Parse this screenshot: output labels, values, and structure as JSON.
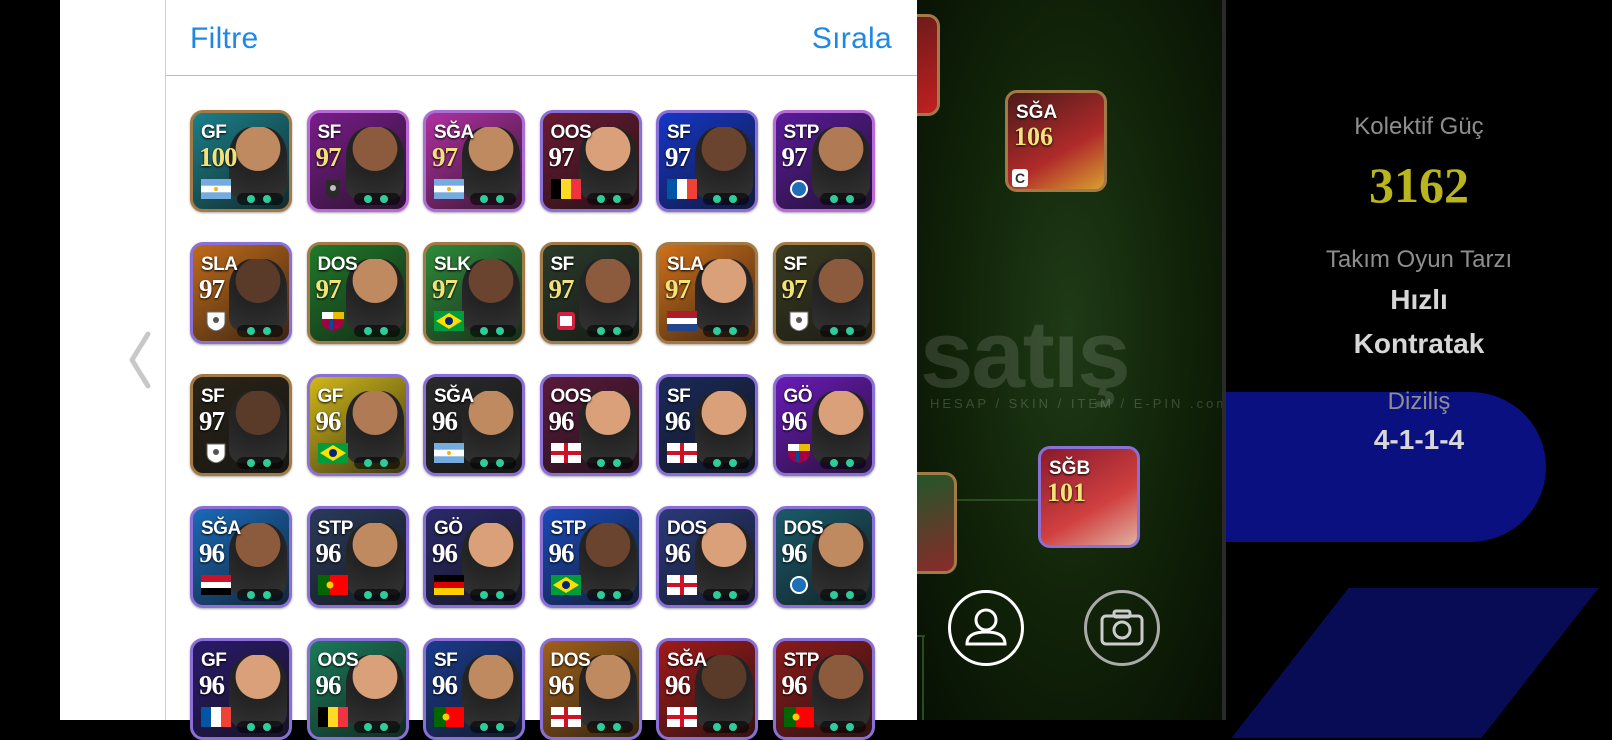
{
  "header": {
    "filter_label": "Filtre",
    "sort_label": "Sırala"
  },
  "watermark": {
    "brand": "satış",
    "tagline": "HESAP / SKIN / ITEM / E-PIN",
    "domain": ".com"
  },
  "team": {
    "power_label": "Kolektif Güç",
    "power_value": "3162",
    "style_label": "Takım Oyun Tarzı",
    "style_value_line1": "Hızlı",
    "style_value_line2": "Kontratak",
    "formation_label": "Diziliş",
    "formation_value": "4-1-1-4"
  },
  "pitch_cards": [
    {
      "pos": "SĞA",
      "rating": "106",
      "marker": "C"
    },
    {
      "pos": "SĞB",
      "rating": "101"
    }
  ],
  "icons": {
    "profile": "person-icon",
    "camera": "camera-icon",
    "back": "chevron-left-icon"
  },
  "cards": [
    {
      "pos": "GF",
      "rating": "100",
      "gold": true,
      "flag": "argentina",
      "bg": "#1a7f8a",
      "frame": "#a27a45",
      "skin": "#c08a60"
    },
    {
      "pos": "SF",
      "rating": "97",
      "gold": true,
      "flag": "club-dark",
      "bg": "#7a1c8a",
      "frame": "#b86bd6",
      "skin": "#8c5a3c"
    },
    {
      "pos": "SĞA",
      "rating": "97",
      "gold": true,
      "flag": "argentina",
      "bg": "#b030a0",
      "frame": "#a86fd6",
      "skin": "#c08a60"
    },
    {
      "pos": "OOS",
      "rating": "97",
      "gold": false,
      "flag": "belgium",
      "bg": "#6a1a32",
      "frame": "#8a6fd6",
      "skin": "#d9a07a"
    },
    {
      "pos": "SF",
      "rating": "97",
      "gold": false,
      "flag": "france",
      "bg": "#1536c8",
      "frame": "#8a6fd6",
      "skin": "#6b4430"
    },
    {
      "pos": "STP",
      "rating": "97",
      "gold": false,
      "flag": "club-blue",
      "bg": "#5a1a9a",
      "frame": "#b86bd6",
      "skin": "#b07a55"
    },
    {
      "pos": "SLA",
      "rating": "97",
      "gold": false,
      "flag": "club-white",
      "bg": "#c06a1a",
      "frame": "#8a6fd6",
      "skin": "#5a3a28"
    },
    {
      "pos": "DOS",
      "rating": "97",
      "gold": true,
      "flag": "barcelona",
      "bg": "#1f7a2a",
      "frame": "#a27a45",
      "skin": "#c08a60"
    },
    {
      "pos": "SLK",
      "rating": "97",
      "gold": true,
      "flag": "brazil",
      "bg": "#2e8a3a",
      "frame": "#a27a45",
      "skin": "#6b4430"
    },
    {
      "pos": "SF",
      "rating": "97",
      "gold": true,
      "flag": "club-red",
      "bg": "#2a3a2a",
      "frame": "#a27a45",
      "skin": "#8c5a3c"
    },
    {
      "pos": "SLA",
      "rating": "97",
      "gold": true,
      "flag": "netherlands",
      "bg": "#d0701a",
      "frame": "#a27a45",
      "skin": "#d9a07a"
    },
    {
      "pos": "SF",
      "rating": "97",
      "gold": true,
      "flag": "club-white",
      "bg": "#3a3a20",
      "frame": "#a27a45",
      "skin": "#8c5a3c"
    },
    {
      "pos": "SF",
      "rating": "97",
      "gold": false,
      "flag": "club-white",
      "bg": "#2a2418",
      "frame": "#a27a45",
      "skin": "#5a3a28"
    },
    {
      "pos": "GF",
      "rating": "96",
      "gold": false,
      "flag": "brazil",
      "bg": "#d0b81a",
      "frame": "#8a6fd6",
      "skin": "#b07a55"
    },
    {
      "pos": "SĞA",
      "rating": "96",
      "gold": false,
      "flag": "argentina",
      "bg": "#2a2a2a",
      "frame": "#8a6fd6",
      "skin": "#c08a60"
    },
    {
      "pos": "OOS",
      "rating": "96",
      "gold": false,
      "flag": "england",
      "bg": "#5a1a3a",
      "frame": "#8a6fd6",
      "skin": "#d9a07a"
    },
    {
      "pos": "SF",
      "rating": "96",
      "gold": false,
      "flag": "england",
      "bg": "#1a2a5a",
      "frame": "#8a6fd6",
      "skin": "#d9a07a"
    },
    {
      "pos": "GÖ",
      "rating": "96",
      "gold": false,
      "flag": "barcelona",
      "bg": "#6a1ab8",
      "frame": "#8a6fd6",
      "skin": "#d9a07a"
    },
    {
      "pos": "SĞA",
      "rating": "96",
      "gold": false,
      "flag": "egypt",
      "bg": "#1a6ab8",
      "frame": "#8a6fd6",
      "skin": "#8c5a3c"
    },
    {
      "pos": "STP",
      "rating": "96",
      "gold": false,
      "flag": "portugal",
      "bg": "#2a3a5a",
      "frame": "#8a6fd6",
      "skin": "#c08a60"
    },
    {
      "pos": "GÖ",
      "rating": "96",
      "gold": false,
      "flag": "germany",
      "bg": "#2a2a6a",
      "frame": "#8a6fd6",
      "skin": "#d9a07a"
    },
    {
      "pos": "STP",
      "rating": "96",
      "gold": false,
      "flag": "brazil",
      "bg": "#1a4ab8",
      "frame": "#8a6fd6",
      "skin": "#6b4430"
    },
    {
      "pos": "DOS",
      "rating": "96",
      "gold": false,
      "flag": "england",
      "bg": "#2a3a7a",
      "frame": "#8a6fd6",
      "skin": "#d9a07a"
    },
    {
      "pos": "DOS",
      "rating": "96",
      "gold": false,
      "flag": "club-blue",
      "bg": "#1a5a6a",
      "frame": "#8a6fd6",
      "skin": "#c08a60"
    },
    {
      "pos": "GF",
      "rating": "96",
      "gold": false,
      "flag": "france",
      "bg": "#2a1a6a",
      "frame": "#8a6fd6",
      "skin": "#d9a07a"
    },
    {
      "pos": "OOS",
      "rating": "96",
      "gold": false,
      "flag": "belgium",
      "bg": "#1a7a5a",
      "frame": "#8a6fd6",
      "skin": "#d9a07a"
    },
    {
      "pos": "SF",
      "rating": "96",
      "gold": false,
      "flag": "portugal",
      "bg": "#1a3a8a",
      "frame": "#8a6fd6",
      "skin": "#c08a60"
    },
    {
      "pos": "DOS",
      "rating": "96",
      "gold": false,
      "flag": "england",
      "bg": "#a0601a",
      "frame": "#8a6fd6",
      "skin": "#c08a60"
    },
    {
      "pos": "SĞA",
      "rating": "96",
      "gold": false,
      "flag": "england",
      "bg": "#a01a1a",
      "frame": "#8a6fd6",
      "skin": "#5a3a28"
    },
    {
      "pos": "STP",
      "rating": "96",
      "gold": false,
      "flag": "portugal",
      "bg": "#8a1a1a",
      "frame": "#8a6fd6",
      "skin": "#8c5a3c"
    }
  ]
}
